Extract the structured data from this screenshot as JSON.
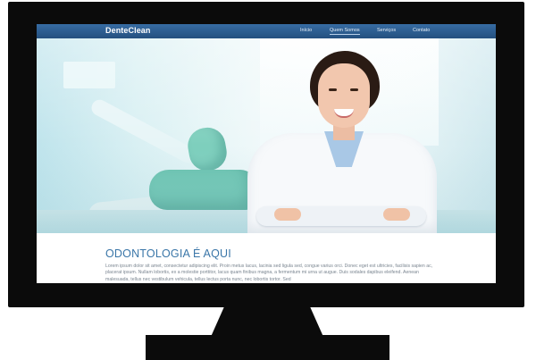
{
  "nav": {
    "logo": "DenteClean",
    "items": [
      "Início",
      "Quem Somos",
      "Serviços",
      "Contato"
    ],
    "active": "Quem Somos"
  },
  "content": {
    "heading": "ODONTOLOGIA É AQUI",
    "paragraph": "Lorem ipsum dolor sit amet, consectetur adipiscing elit. Proin metus lacus, lacinia sed ligula sed, congue varius orci. Donec eget est ultricies, facilisis sapien ac, placerat ipsum. Nullam lobortis, ex a molestie porttitor, lacus quam finibus magna, a fermentum mi urna ut augue. Duis sodales dapibus eleifend. Aenean malesuada, tellus nec vestibulum vehicula, tellus lectus porta nunc, nec lobortis tortor. Sed"
  },
  "colors": {
    "nav_bar": "#2f5f93",
    "heading": "#3a76a8",
    "body_text": "#7a8590",
    "monitor": "#0b0b0b"
  }
}
